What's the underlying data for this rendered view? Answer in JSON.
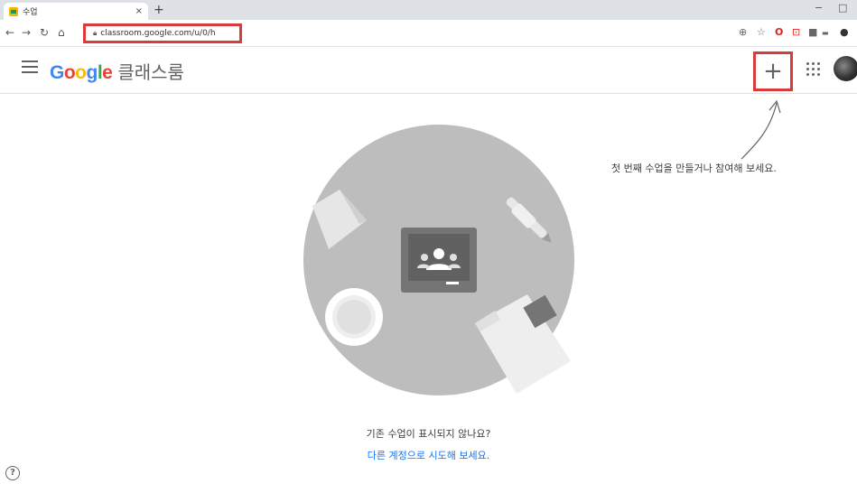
{
  "browser": {
    "tab_title": "수업",
    "tab_close": "×",
    "new_tab": "+",
    "url": "classroom.google.com/u/0/h",
    "window_min": "−",
    "window_max": "□"
  },
  "app": {
    "brand_logo": "Google",
    "product_name": "클래스룸",
    "create_button": "+",
    "hint": "첫 번째 수업을 만들거나 참여해 보세요.",
    "question": "기존 수업이 표시되지 않나요?",
    "switch_account_link": "다른 계정으로 시도해 보세요.",
    "help": "?"
  },
  "colors": {
    "accent_red": "#d93a3a",
    "link_blue": "#1a73e8",
    "circle_gray": "#bdbdbd"
  }
}
